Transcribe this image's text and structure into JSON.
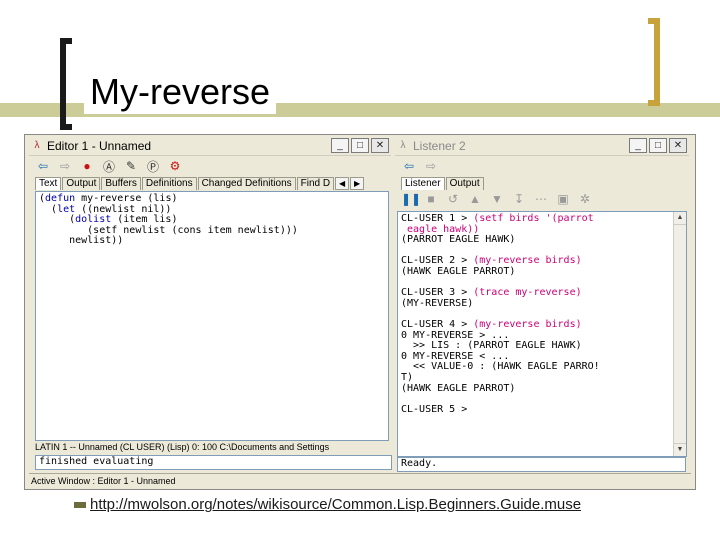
{
  "slide": {
    "title": "My-reverse",
    "url": "http://mwolson.org/notes/wikisource/Common.Lisp.Beginners.Guide.muse"
  },
  "editor": {
    "title": "Editor 1 - Unnamed",
    "tabs": [
      "Text",
      "Output",
      "Buffers",
      "Definitions",
      "Changed Definitions",
      "Find D"
    ],
    "code_lines": [
      "(defun my-reverse (lis)",
      "  (let ((newlist nil))",
      "     (dolist (item lis)",
      "        (setf newlist (cons item newlist)))",
      "     newlist))"
    ],
    "status": "LATIN 1 --  Unnamed   (CL USER)  (Lisp) 0: 100 C:\\Documents and Settings",
    "echo": "finished evaluating"
  },
  "listener": {
    "title": "Listener 2",
    "tabs": [
      "Listener",
      "Output"
    ],
    "lines": [
      {
        "text": "CL-USER 1 > ",
        "input": "(setf birds '(parrot"
      },
      {
        "text": "",
        "input": " eagle hawk))"
      },
      {
        "text": "(PARROT EAGLE HAWK)",
        "input": ""
      },
      {
        "text": "",
        "input": ""
      },
      {
        "text": "CL-USER 2 > ",
        "input": "(my-reverse birds)"
      },
      {
        "text": "(HAWK EAGLE PARROT)",
        "input": ""
      },
      {
        "text": "",
        "input": ""
      },
      {
        "text": "CL-USER 3 > ",
        "input": "(trace my-reverse)"
      },
      {
        "text": "(MY-REVERSE)",
        "input": ""
      },
      {
        "text": "",
        "input": ""
      },
      {
        "text": "CL-USER 4 > ",
        "input": "(my-reverse birds)"
      },
      {
        "text": "0 MY-REVERSE > ...",
        "input": ""
      },
      {
        "text": "  >> LIS : (PARROT EAGLE HAWK)",
        "input": ""
      },
      {
        "text": "0 MY-REVERSE < ...",
        "input": ""
      },
      {
        "text": "  << VALUE-0 : (HAWK EAGLE PARRO!",
        "input": ""
      },
      {
        "text": "T)",
        "input": ""
      },
      {
        "text": "(HAWK EAGLE PARROT)",
        "input": ""
      },
      {
        "text": "",
        "input": ""
      },
      {
        "text": "CL-USER 5 > ",
        "input": ""
      }
    ],
    "echo": "Ready."
  },
  "active_window": "Active Window : Editor 1 - Unnamed",
  "colors": {
    "keyword": "#0000aa",
    "input": "#cc0077",
    "accent_gold": "#c8a23a",
    "bar": "#cccc99"
  }
}
